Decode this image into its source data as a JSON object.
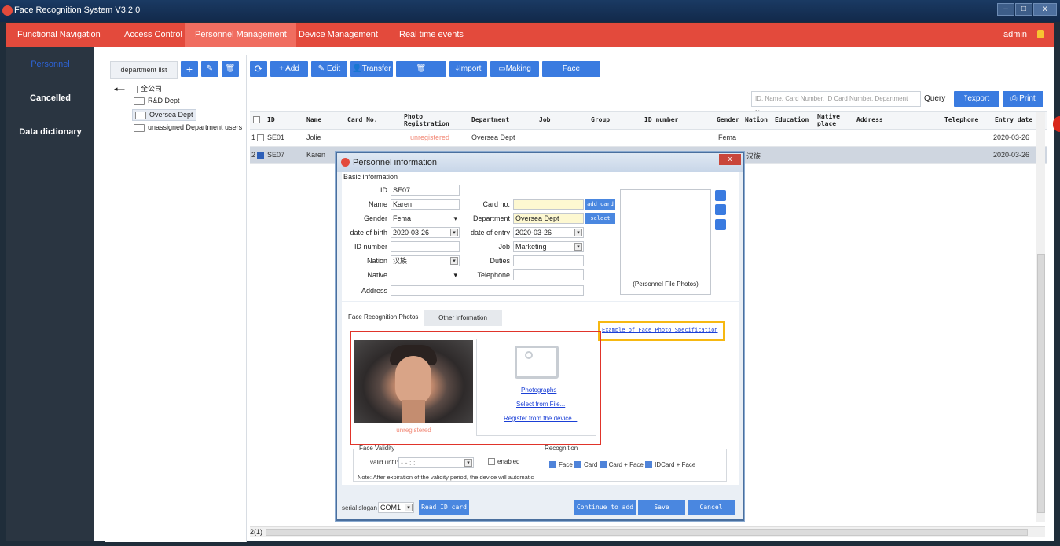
{
  "app": {
    "title": "Face Recognition System V3.2.0",
    "win_buttons": [
      "–",
      "□",
      "x"
    ]
  },
  "menu": {
    "items": [
      "Functional Navigation",
      "Access Control",
      "Personnel Management",
      "Device Management",
      "Real time events"
    ],
    "admin": "admin"
  },
  "sidebar": {
    "items": [
      "Personnel",
      "Cancelled",
      "Data dictionary"
    ]
  },
  "tree": {
    "header": "department list",
    "root": "全公司",
    "children": [
      "R&D Dept",
      "Oversea Dept",
      "unassigned Department users"
    ]
  },
  "toolbar": {
    "add": "Add",
    "edit": "Edit",
    "transfer": "Transfer",
    "cancellation": "Cancellation",
    "import": "Import",
    "making_card": "Making card",
    "face_management": "Face Management"
  },
  "search": {
    "placeholder": "ID, Name, Card Number, ID Card Number, Department Name",
    "query": "Query",
    "export": "export",
    "print": "Print"
  },
  "grid": {
    "columns": [
      "ID",
      "Name",
      "Card No.",
      "Photo Registration",
      "Department",
      "Job",
      "Group",
      "ID number",
      "Gender",
      "Nation",
      "Education",
      "Native place",
      "Address",
      "Telephone",
      "Entry date"
    ],
    "rows": [
      {
        "num": "1",
        "id": "SE01",
        "name": "Jolie",
        "photo": "unregistered",
        "department": "Oversea Dept",
        "gender": "Fema",
        "nation": "",
        "entry": "2020-03-26"
      },
      {
        "num": "2",
        "id": "SE07",
        "name": "Karen",
        "photo": "",
        "department": "",
        "gender": "",
        "nation": "汉族",
        "entry": "2020-03-26"
      }
    ],
    "pager": "2(1)"
  },
  "dialog": {
    "title": "Personnel information",
    "basic_info": "Basic information",
    "labels": {
      "id": "ID",
      "name": "Name",
      "gender": "Gender",
      "dob": "date of birth",
      "id_number": "ID number",
      "nation": "Nation",
      "native": "Native",
      "address": "Address",
      "card_no": "Card no.",
      "department": "Department",
      "date_entry": "date of entry",
      "job": "Job",
      "duties": "Duties",
      "telephone": "Telephone"
    },
    "values": {
      "id": "SE07",
      "name": "Karen",
      "gender": "Fema",
      "dob": "2020-03-26",
      "id_number": "",
      "nation": "汉族",
      "native": "",
      "address": "",
      "card_no": "",
      "department": "Oversea Dept",
      "date_entry": "2020-03-26",
      "job": "Marketing",
      "duties": "",
      "telephone": ""
    },
    "add_card": "add card",
    "select": "select",
    "file_photos": "(Personnel File Photos)",
    "tabs": [
      "Face Recognition Photos",
      "Other information"
    ],
    "example_link": "Example of Face Photo Specification",
    "face_status": "unregistered",
    "photo_links": [
      "Photographs",
      "Select from File...",
      "Register from the device..."
    ],
    "validity": {
      "title": "Face Validity",
      "valid_until": "valid until:",
      "date_placeholder": "- -  : :",
      "enabled": "enabled",
      "note": "Note: After expiration of the validity period, the device will automatic"
    },
    "recognition": {
      "title": "Recognition",
      "options": [
        "Face",
        "Card",
        "Card + Face",
        "IDCard + Face"
      ]
    },
    "footer": {
      "serial_label": "serial slogan",
      "port": "COM1",
      "read_id": "Read ID card",
      "continue": "Continue to add",
      "save": "Save",
      "cancel": "Cancel"
    }
  }
}
